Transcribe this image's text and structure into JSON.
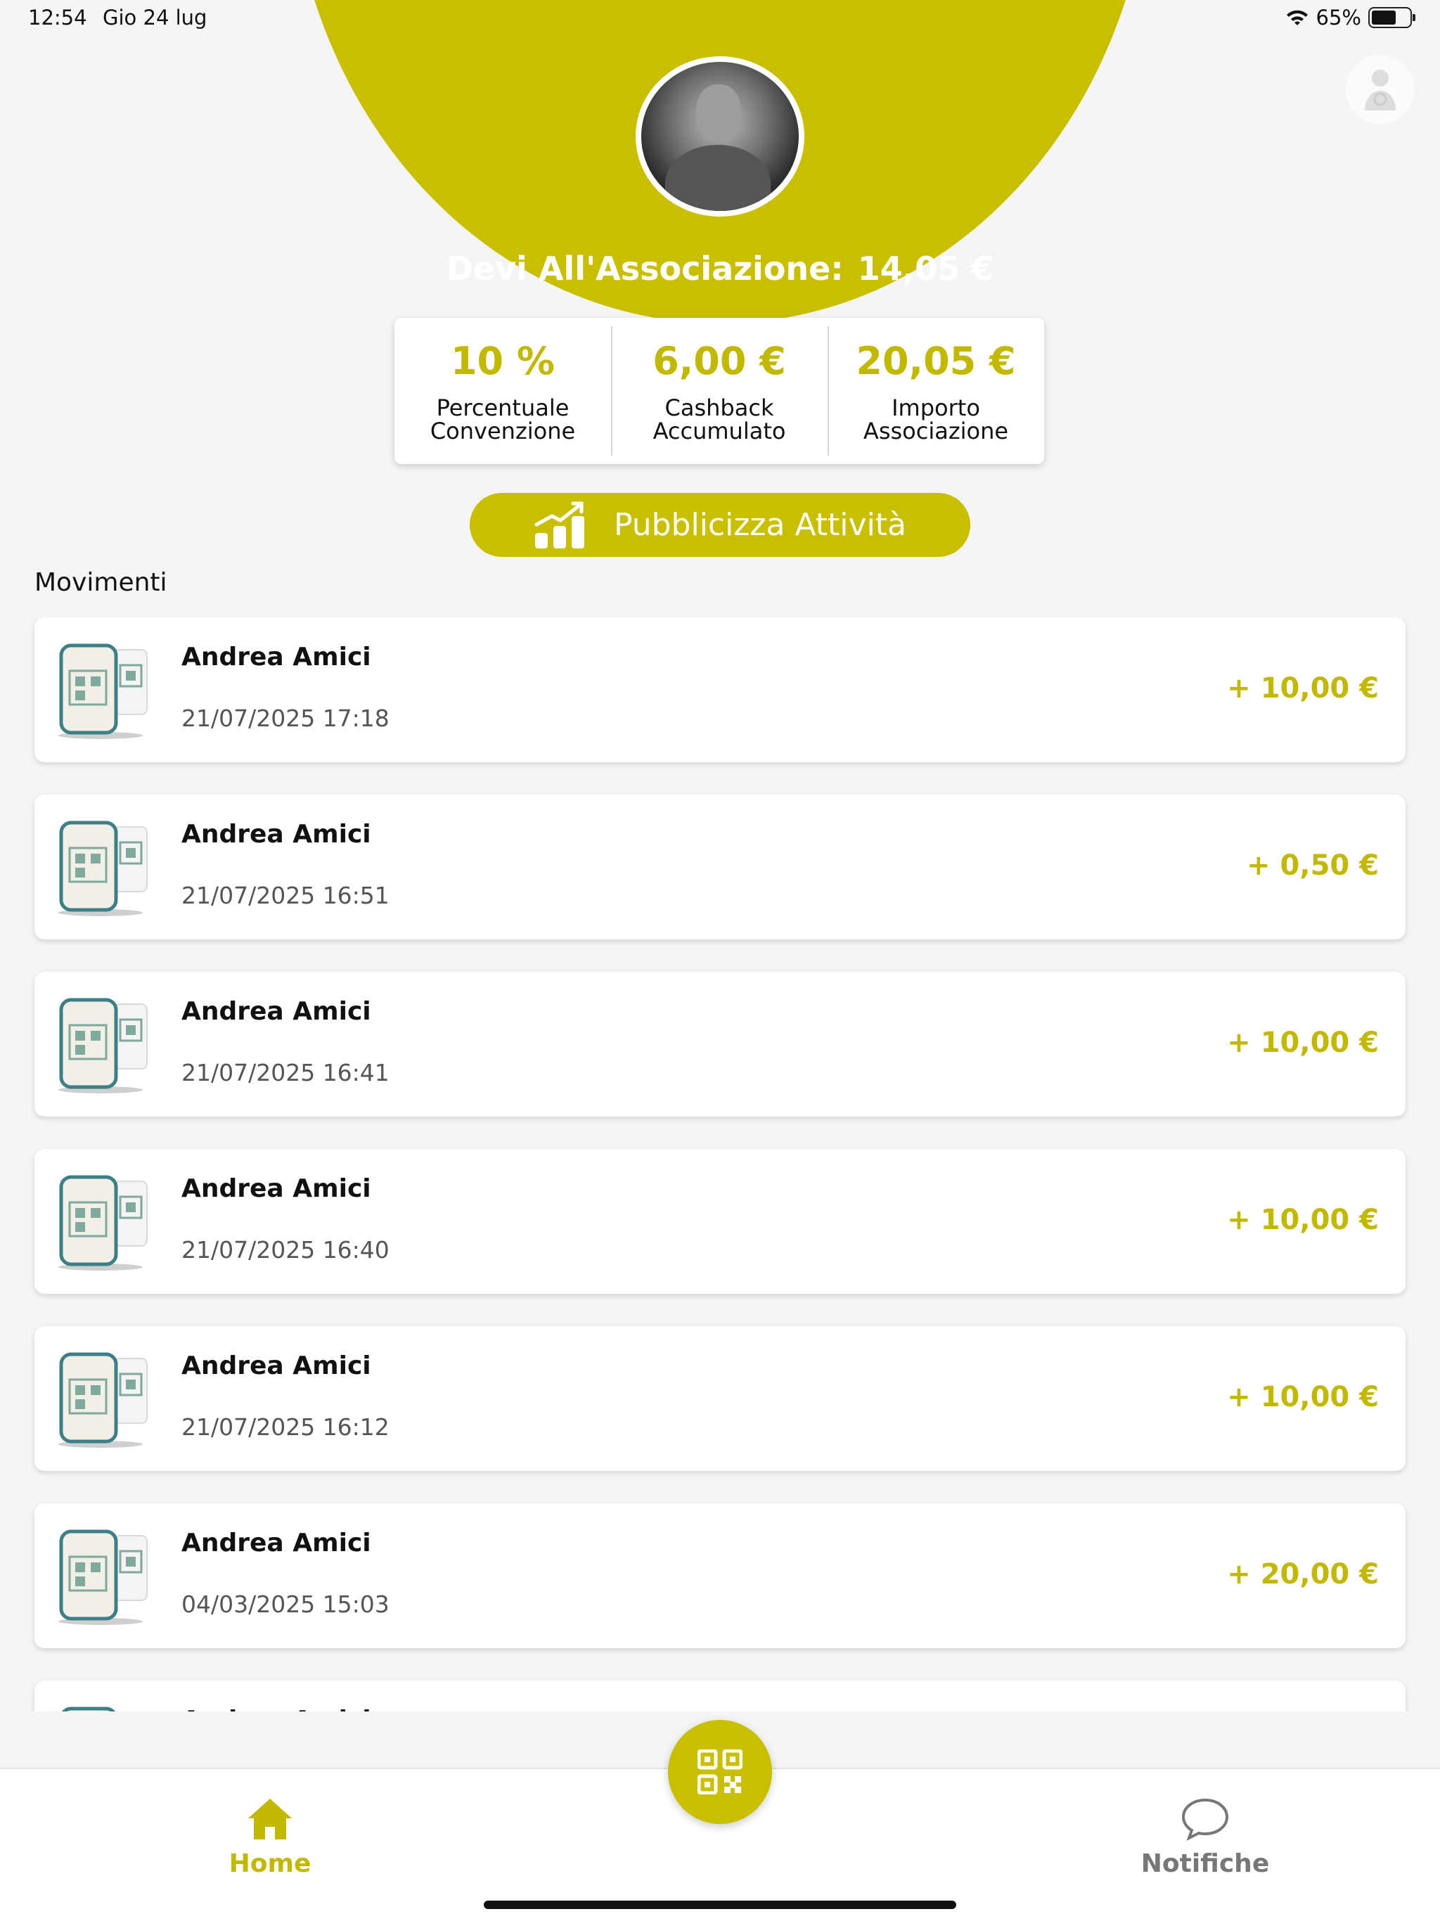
{
  "status_bar": {
    "time": "12:54",
    "date": "Gio 24 lug",
    "battery": "65%"
  },
  "header": {
    "owe_label": "Devi All'Associazione:",
    "owe_amount": "14,05 €"
  },
  "stats": [
    {
      "value": "10 %",
      "label": "Percentuale\nConvenzione"
    },
    {
      "value": "6,00 €",
      "label": "Cashback\nAccumulato"
    },
    {
      "value": "20,05 €",
      "label": "Importo\nAssociazione"
    }
  ],
  "promo_button": {
    "label": "Pubblicizza Attività"
  },
  "movements": {
    "title": "Movimenti",
    "items": [
      {
        "name": "Andrea Amici",
        "date": "21/07/2025 17:18",
        "amount": "+ 10,00 €"
      },
      {
        "name": "Andrea Amici",
        "date": "21/07/2025 16:51",
        "amount": "+ 0,50 €"
      },
      {
        "name": "Andrea Amici",
        "date": "21/07/2025 16:41",
        "amount": "+ 10,00 €"
      },
      {
        "name": "Andrea Amici",
        "date": "21/07/2025 16:40",
        "amount": "+ 10,00 €"
      },
      {
        "name": "Andrea Amici",
        "date": "21/07/2025 16:12",
        "amount": "+ 10,00 €"
      },
      {
        "name": "Andrea Amici",
        "date": "04/03/2025 15:03",
        "amount": "+ 20,00 €"
      },
      {
        "name": "Andrea Amici",
        "date": "",
        "amount": ""
      }
    ]
  },
  "tabbar": {
    "home": "Home",
    "notifications": "Notifiche"
  },
  "icons": {
    "avatar": "profile-photo",
    "corner": "user-icon",
    "promo": "growth-chart-icon",
    "thumb": "phone-qr-icon",
    "fab": "qr-code-icon",
    "home": "home-icon",
    "notifications": "chat-bubble-icon"
  },
  "colors": {
    "accent": "#c9bf00",
    "accent_text": "#c3b800",
    "background": "#f5f5f5"
  }
}
